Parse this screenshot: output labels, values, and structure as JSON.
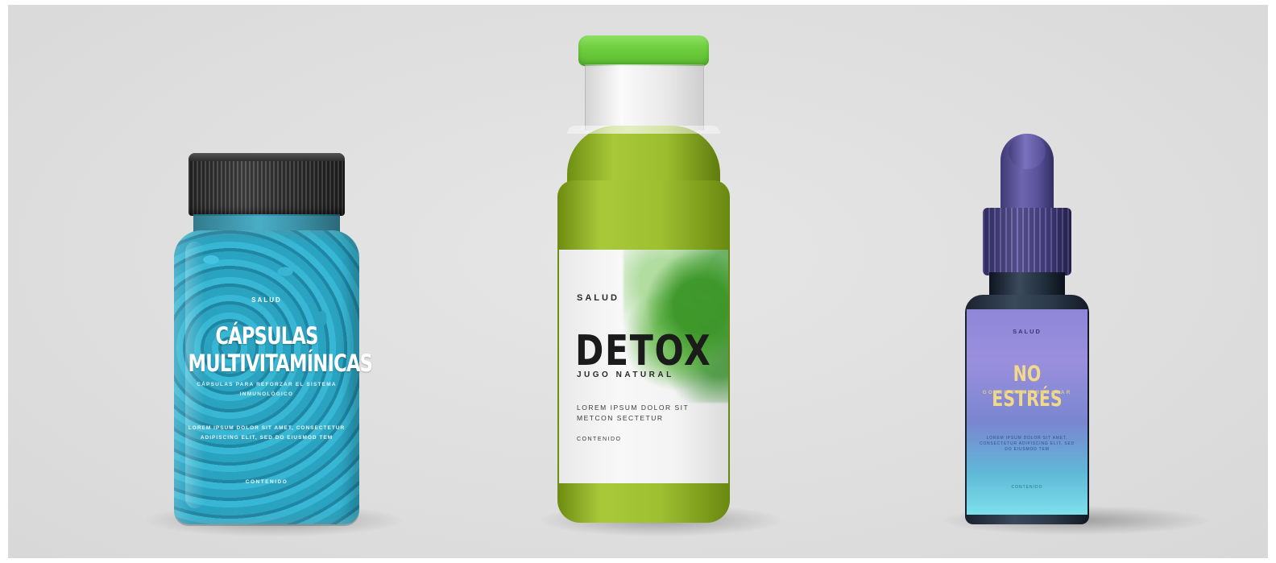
{
  "jar": {
    "salud": "SALUD",
    "title_line1": "CÁPSULAS",
    "title_line2": "MULTIVITAMÍNICAS",
    "subtitle": "CÁPSULAS PARA REFORZAR EL SISTEMA INMUNOLÓGICO",
    "lorem": "LOREM IPSUM DOLOR SIT AMET, CONSECTETUR ADIPISCING ELIT, SED DO EIUSMOD TEM",
    "contenido": "CONTENIDO"
  },
  "bottle": {
    "salud": "SALUD",
    "title": "DETOX",
    "subtitle": "JUGO NATURAL",
    "lorem": "LOREM IPSUM DOLOR SIT METCON SECTETUR",
    "contenido": "CONTENIDO"
  },
  "dropper": {
    "salud": "SALUD",
    "title": "NO ESTRÉS",
    "subtitle": "GOTAS PARA RELAJAR",
    "lorem": "LOREM IPSUM DOLOR SIT AMET, CONSECTETUR ADIPISCING ELIT, SED DO EIUSMOD TEM",
    "contenido": "CONTENIDO"
  }
}
